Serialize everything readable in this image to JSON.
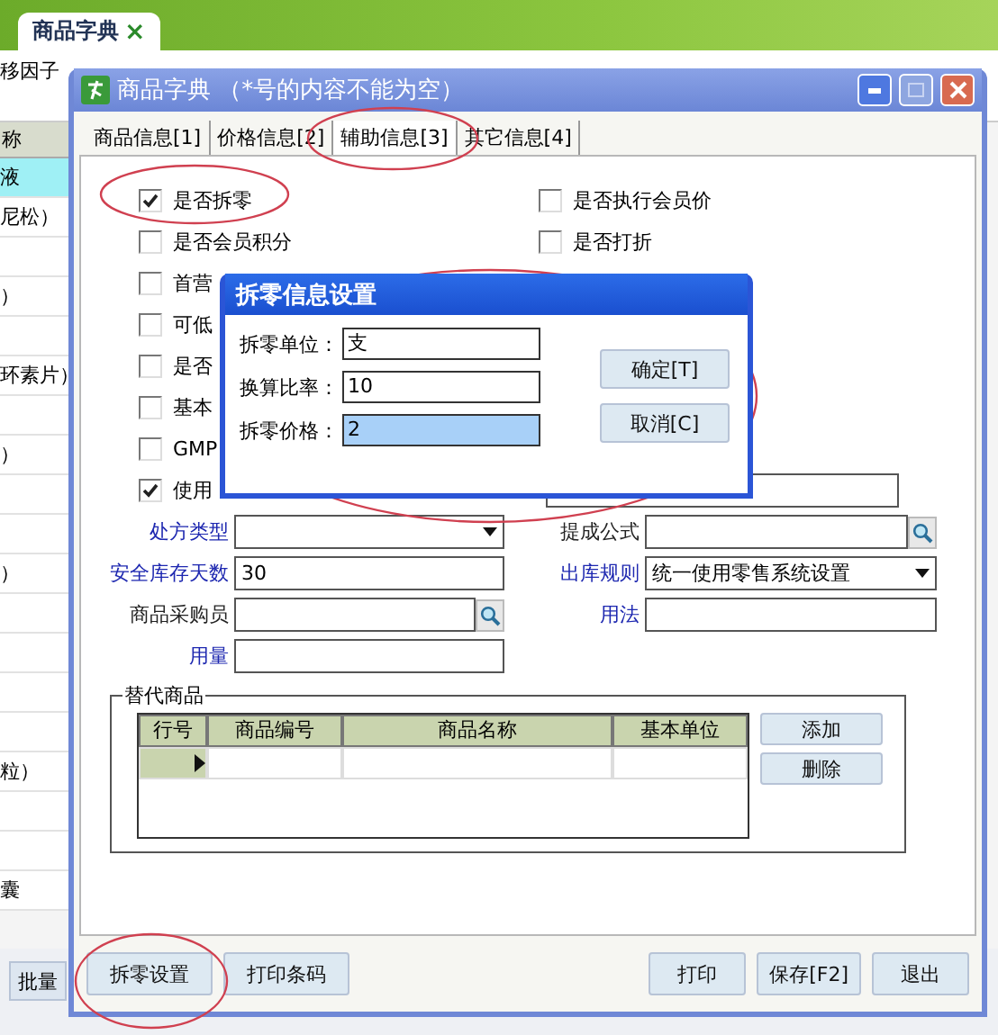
{
  "app": {
    "tab": {
      "label": "商品字典",
      "close": "×"
    },
    "toolbar_text": "移因子",
    "list_header": "称",
    "list_rows": [
      {
        "text": "液",
        "selected": true
      },
      {
        "text": "尼松）",
        "selected": false
      },
      {
        "selected": false
      },
      {
        "text": "）",
        "selected": false
      },
      {
        "selected": false
      },
      {
        "text": "环素片）",
        "selected": false
      },
      {
        "selected": false
      },
      {
        "text": "）",
        "selected": false
      },
      {
        "selected": false
      },
      {
        "selected": false
      },
      {
        "text": "）",
        "selected": false
      },
      {
        "selected": false
      },
      {
        "selected": false
      },
      {
        "selected": false
      },
      {
        "selected": false
      },
      {
        "text": "粒）",
        "selected": false
      },
      {
        "selected": false
      },
      {
        "selected": false
      },
      {
        "text": "囊",
        "selected": false
      }
    ],
    "left_button": "批量"
  },
  "dialog": {
    "title": "商品字典 （*号的内容不能为空）",
    "tabs": [
      {
        "label": "商品信息[1]",
        "selected": false
      },
      {
        "label": "价格信息[2]",
        "selected": false
      },
      {
        "label": "辅助信息[3]",
        "selected": true
      },
      {
        "label": "其它信息[4]",
        "selected": false
      }
    ],
    "checkboxes_left": [
      {
        "label": "是否拆零",
        "checked": true
      },
      {
        "label": "是否会员积分",
        "checked": false
      },
      {
        "label": "首营",
        "checked": false
      },
      {
        "label": "可低",
        "checked": false
      },
      {
        "label": "是否",
        "checked": false
      },
      {
        "label": "基本",
        "checked": false
      },
      {
        "label": "GMP",
        "checked": false
      },
      {
        "label": "使用",
        "checked": true
      }
    ],
    "checkboxes_right": [
      {
        "label": "是否执行会员价",
        "checked": false
      },
      {
        "label": "是否打折",
        "checked": false
      }
    ],
    "form_left": [
      {
        "label": "处方类型",
        "highlighted": true,
        "kind": "select"
      },
      {
        "label": "安全库存天数",
        "highlighted": true,
        "kind": "text",
        "value": "30"
      },
      {
        "label": "商品采购员",
        "highlighted": false,
        "kind": "lookup"
      },
      {
        "label": "用量",
        "highlighted": true,
        "kind": "text"
      }
    ],
    "form_right": [
      {
        "label": "提成公式",
        "highlighted": false,
        "kind": "lookup"
      },
      {
        "label": "出库规则",
        "highlighted": true,
        "kind": "select",
        "value": "统一使用零售系统设置"
      },
      {
        "label": "用法",
        "highlighted": true,
        "kind": "text"
      }
    ],
    "substitute": {
      "title": "替代商品",
      "columns": [
        "行号",
        "商品编号",
        "商品名称",
        "基本单位"
      ],
      "rows": [
        {
          "current": true
        }
      ],
      "buttons": [
        "添加",
        "删除"
      ]
    },
    "footer_left": [
      "拆零设置",
      "打印条码"
    ],
    "footer_right": [
      "打印",
      "保存[F2]",
      "退出"
    ]
  },
  "split_dialog": {
    "title": "拆零信息设置",
    "fields": [
      {
        "label": "拆零单位：",
        "value": "支",
        "selected": false
      },
      {
        "label": "换算比率：",
        "value": "10",
        "selected": false
      },
      {
        "label": "拆零价格：",
        "value": "2",
        "selected": true
      }
    ],
    "buttons": [
      "确定[T]",
      "取消[C]"
    ]
  }
}
